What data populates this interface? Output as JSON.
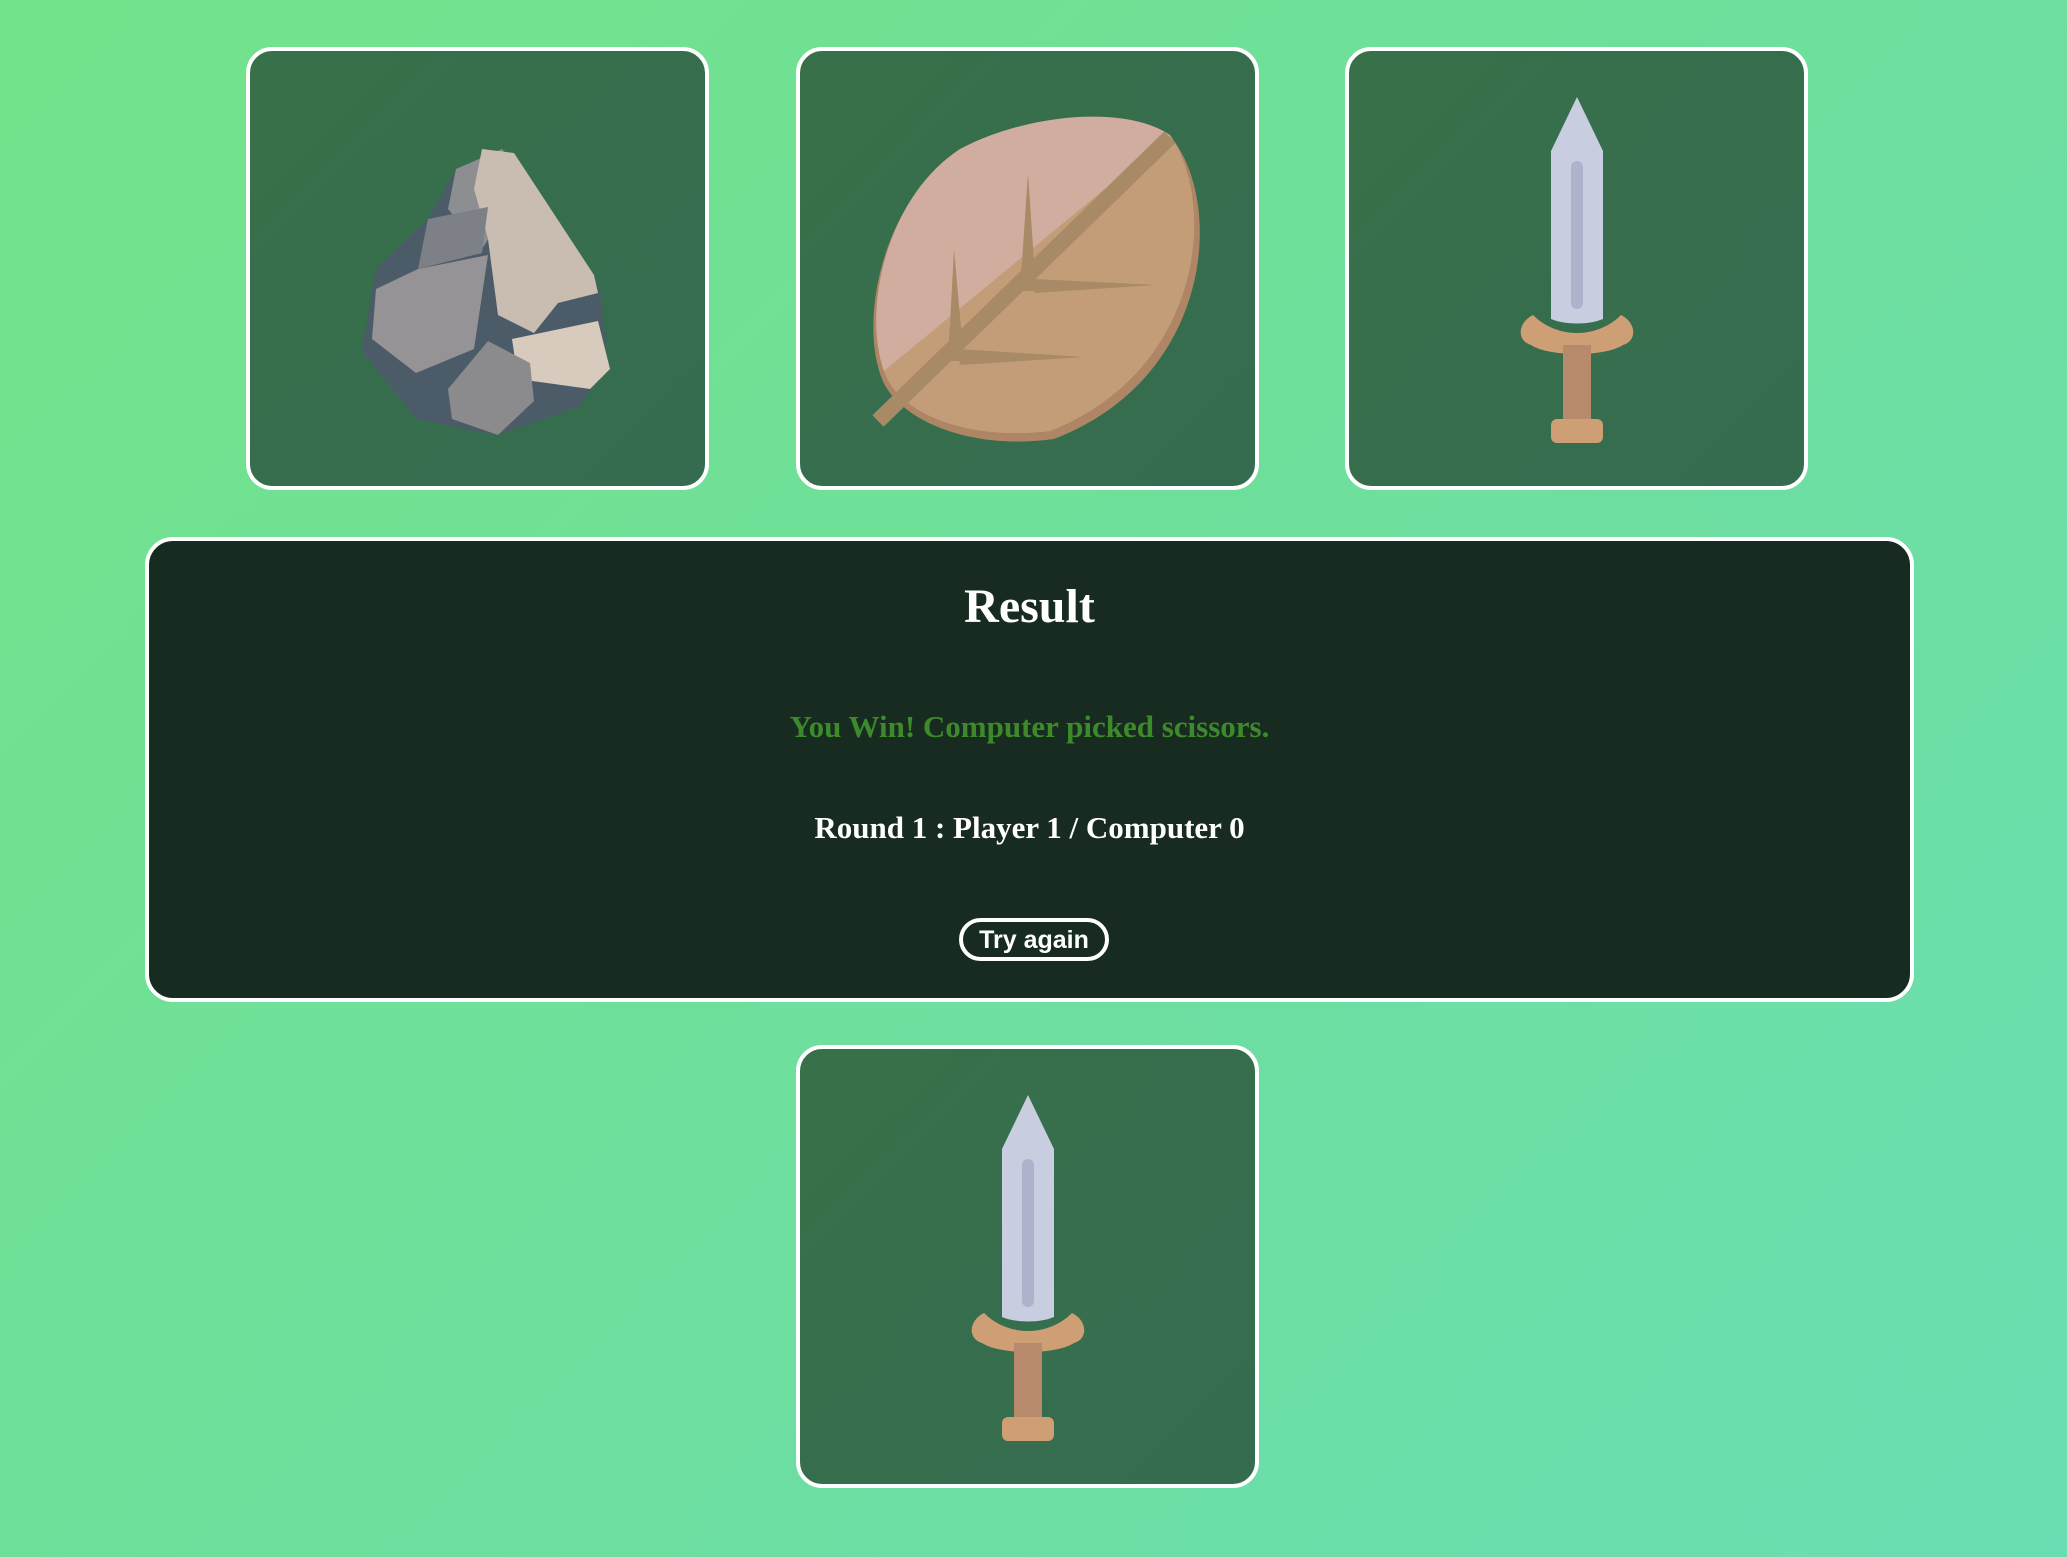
{
  "choices": [
    {
      "id": "rock",
      "icon": "rock-icon"
    },
    {
      "id": "paper",
      "icon": "leaf-icon"
    },
    {
      "id": "scissors",
      "icon": "sword-icon"
    }
  ],
  "result": {
    "title": "Result",
    "message": "You Win! Computer picked scissors.",
    "score_line": "Round 1 : Player 1 / Computer 0",
    "try_again_label": "Try again"
  },
  "computer_choice": {
    "id": "scissors",
    "icon": "sword-icon"
  },
  "colors": {
    "background_start": "#72e38a",
    "background_end": "#6bddb2",
    "card_bg": "#38704a",
    "panel_bg": "#182b21",
    "win_text": "#3c8a2a",
    "border": "#ffffff"
  }
}
